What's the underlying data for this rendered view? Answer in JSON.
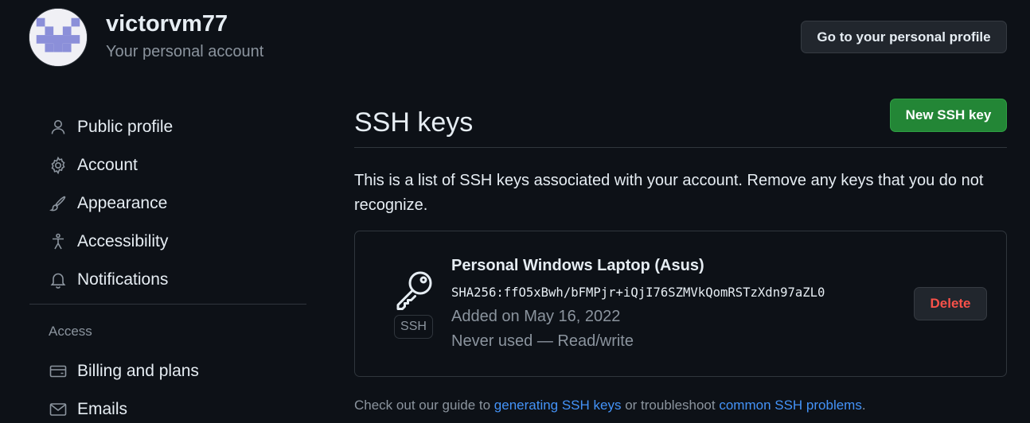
{
  "header": {
    "username": "victorvm77",
    "account_type": "Your personal account",
    "profile_button": "Go to your personal profile"
  },
  "sidebar": {
    "items": [
      {
        "label": "Public profile",
        "icon": "person-icon"
      },
      {
        "label": "Account",
        "icon": "gear-icon"
      },
      {
        "label": "Appearance",
        "icon": "paintbrush-icon"
      },
      {
        "label": "Accessibility",
        "icon": "accessibility-icon"
      },
      {
        "label": "Notifications",
        "icon": "bell-icon"
      }
    ],
    "access_heading": "Access",
    "access_items": [
      {
        "label": "Billing and plans",
        "icon": "credit-card-icon"
      },
      {
        "label": "Emails",
        "icon": "mail-icon"
      }
    ]
  },
  "main": {
    "title": "SSH keys",
    "new_key_button": "New SSH key",
    "description": "This is a list of SSH keys associated with your account. Remove any keys that you do not recognize.",
    "keys": [
      {
        "name": "Personal Windows Laptop (Asus)",
        "fingerprint": "SHA256:ffO5xBwh/bFMPjr+iQjI76SZMVkQomRSTzXdn97aZL0",
        "added": "Added on May 16, 2022",
        "usage": "Never used — Read/write",
        "type_label": "SSH",
        "delete_button": "Delete"
      }
    ],
    "footer": {
      "prefix": "Check out our guide to ",
      "link1": "generating SSH keys",
      "middle": " or troubleshoot ",
      "link2": "common SSH problems",
      "suffix": "."
    }
  },
  "colors": {
    "background": "#0d1117",
    "primary_button": "#238636",
    "danger_text": "#f85149",
    "link": "#4493f8",
    "muted_text": "#8b949e"
  }
}
